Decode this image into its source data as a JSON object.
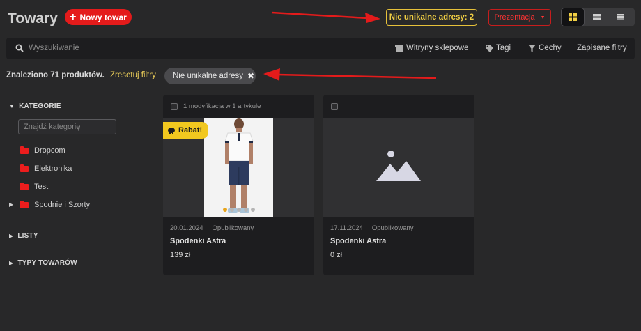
{
  "header": {
    "title": "Towary",
    "new_button": "Nowy towar",
    "nonunique_button": "Nie unikalne adresy: 2",
    "presentation_button": "Prezentacja",
    "views": [
      "grid",
      "list",
      "compact"
    ]
  },
  "search": {
    "placeholder": "Wyszukiwanie",
    "tools": [
      {
        "label": "Witryny sklepowe",
        "icon": "storefront-icon"
      },
      {
        "label": "Tagi",
        "icon": "tag-icon"
      },
      {
        "label": "Cechy",
        "icon": "filter-icon"
      },
      {
        "label": "Zapisane filtry",
        "icon": ""
      }
    ]
  },
  "filters": {
    "found_text": "Znaleziono 71 produktów.",
    "reset_label": "Zresetuj filtry",
    "active_chip": "Nie unikalne adresy"
  },
  "sidebar": {
    "categories_title": "KATEGORIE",
    "category_search_placeholder": "Znajdź kategorię",
    "categories": [
      {
        "label": "Dropcom",
        "expandable": false
      },
      {
        "label": "Elektronika",
        "expandable": false
      },
      {
        "label": "Test",
        "expandable": false
      },
      {
        "label": "Spodnie i Szorty",
        "expandable": true
      }
    ],
    "lists_title": "LISTY",
    "types_title": "TYPY TOWARÓW"
  },
  "products": [
    {
      "header": "1 modyfikacja w 1 artykule",
      "badge": "Rabat!",
      "date": "20.01.2024",
      "status": "Opublikowany",
      "name": "Spodenki Astra",
      "price": "139 zł",
      "has_photo": true
    },
    {
      "header": "",
      "badge": "",
      "date": "17.11.2024",
      "status": "Opublikowany",
      "name": "Spodenki Astra",
      "price": "0 zł",
      "has_photo": false
    }
  ],
  "colors": {
    "accent_red": "#e41b1b",
    "warning_yellow": "#f1cf44",
    "background": "#282829",
    "panel": "#1d1d1f"
  }
}
